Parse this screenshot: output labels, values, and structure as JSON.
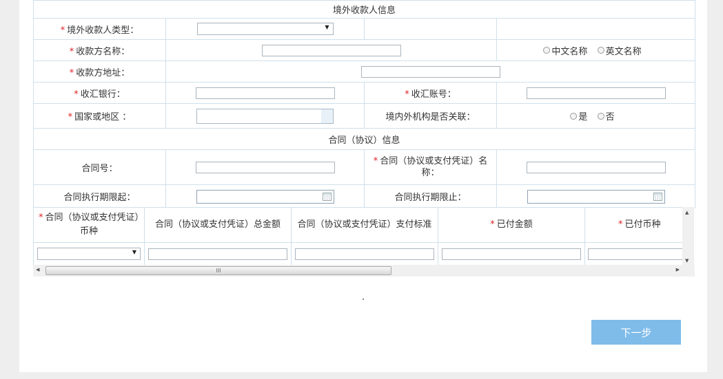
{
  "payee_section": {
    "title": "境外收款人信息",
    "payee_type_label": "境外收款人类型：",
    "payee_type_value": "",
    "payee_name_label": "收款方名称：",
    "name_lang_options": [
      "中文名称",
      "英文名称"
    ],
    "payee_address_label": "收款方地址：",
    "bank_label": "收汇银行：",
    "account_label": "收汇账号：",
    "country_label": "国家或地区 ：",
    "related_label": "境内外机构是否关联：",
    "related_options": [
      "是",
      "否"
    ]
  },
  "contract_section": {
    "title": "合同（协议）信息",
    "contract_no_label": "合同号：",
    "contract_name_label": "合同（协议或支付凭证）名称：",
    "start_label": "合同执行期限起：",
    "end_label": "合同执行期限止："
  },
  "grid": {
    "columns": [
      {
        "label": "合同（协议或支付凭证）币种",
        "required": true
      },
      {
        "label": "合同（协议或支付凭证）总金额",
        "required": false
      },
      {
        "label": "合同（协议或支付凭证）支付标准",
        "required": false
      },
      {
        "label": "已付金额",
        "required": true
      },
      {
        "label": "已付币种",
        "required": true
      }
    ],
    "scroll_thumb_glyph": "III"
  },
  "next_button_label": "下一步",
  "colors": {
    "required_marker": "#e02020",
    "border": "#cfe0ea",
    "button": "#7fbcea",
    "page_bg": "#eeeeee"
  },
  "icons": [
    "dropdown-arrow-icon",
    "calendar-icon",
    "scroll-up-icon",
    "scroll-down-icon",
    "scroll-left-icon",
    "scroll-right-icon"
  ]
}
